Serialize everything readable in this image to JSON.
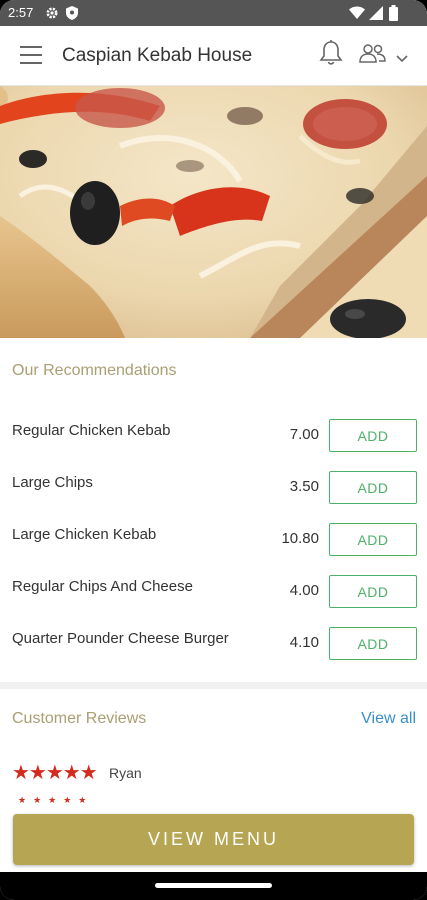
{
  "status_bar": {
    "time": "2:57",
    "icons": [
      "gear-icon",
      "shield-icon",
      "wifi-icon",
      "signal-icon",
      "battery-icon"
    ]
  },
  "app_bar": {
    "title": "Caspian Kebab House",
    "icons": [
      "menu-icon",
      "bell-icon",
      "users-icon",
      "chevron-down-icon"
    ]
  },
  "hero": {
    "image": "pizza-photo"
  },
  "recommendations": {
    "title": "Our Recommendations",
    "items": [
      {
        "name": "Regular Chicken Kebab",
        "price": "7.00",
        "action": "ADD"
      },
      {
        "name": "Large Chips",
        "price": "3.50",
        "action": "ADD"
      },
      {
        "name": "Large Chicken Kebab",
        "price": "10.80",
        "action": "ADD"
      },
      {
        "name": "Regular Chips And Cheese",
        "price": "4.00",
        "action": "ADD"
      },
      {
        "name": "Quarter Pounder Cheese Burger",
        "price": "4.10",
        "action": "ADD"
      }
    ]
  },
  "reviews": {
    "title": "Customer Reviews",
    "view_all": "View all",
    "items": [
      {
        "stars": "★★★★★",
        "rating": 5,
        "name": "Ryan"
      },
      {
        "stars": "★★★★★",
        "rating": 5,
        "name": ""
      }
    ]
  },
  "bottom": {
    "view_menu": "VIEW MENU"
  },
  "colors": {
    "accent": "#b6a653",
    "section_title": "#a99f73",
    "add_green": "#4fb06a",
    "star_red": "#d32c1f",
    "link_blue": "#3a8fc7"
  }
}
